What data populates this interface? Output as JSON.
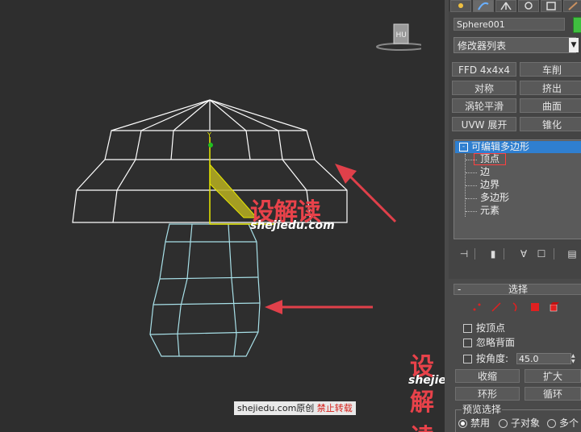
{
  "viewport": {
    "cube_label": "HU",
    "watermark_cn": "设解读",
    "watermark_url": "shejiedu.com",
    "credit_site": "shejiedu.com",
    "credit_original": "原创",
    "credit_forbid": "禁止转载",
    "gizmo_axis": "Y",
    "colors": {
      "wire": "#ffffff",
      "wire_selected": "#a8e0e8",
      "arrow": "#e0404a",
      "gizmo": "#e8e800"
    }
  },
  "panel": {
    "tab_icons": [
      "sun-icon",
      "curve-icon",
      "hierarchy-icon",
      "motion-icon",
      "display-icon",
      "utilities-icon"
    ],
    "object_name": "Sphere001",
    "object_color": "#3fbf3f",
    "modifier_list": "修改器列表",
    "modifier_buttons": [
      "FFD 4x4x4",
      "车削",
      "对称",
      "挤出",
      "涡轮平滑",
      "曲面",
      "UVW 展开",
      "锥化"
    ],
    "stack": {
      "root": "可编辑多边形",
      "root_toggle": "-",
      "items": [
        "顶点",
        "边",
        "边界",
        "多边形",
        "元素"
      ]
    },
    "selection": {
      "title": "选择",
      "collapse": "-",
      "by_vertex": "按顶点",
      "ignore_backface": "忽略背面",
      "angle_label": "按角度:",
      "angle_value": "45.0",
      "shrink": "收缩",
      "grow": "扩大",
      "ring": "环形",
      "loop": "循环",
      "preview_title": "预览选择",
      "preview_options": [
        "禁用",
        "子对象",
        "多个"
      ]
    }
  }
}
